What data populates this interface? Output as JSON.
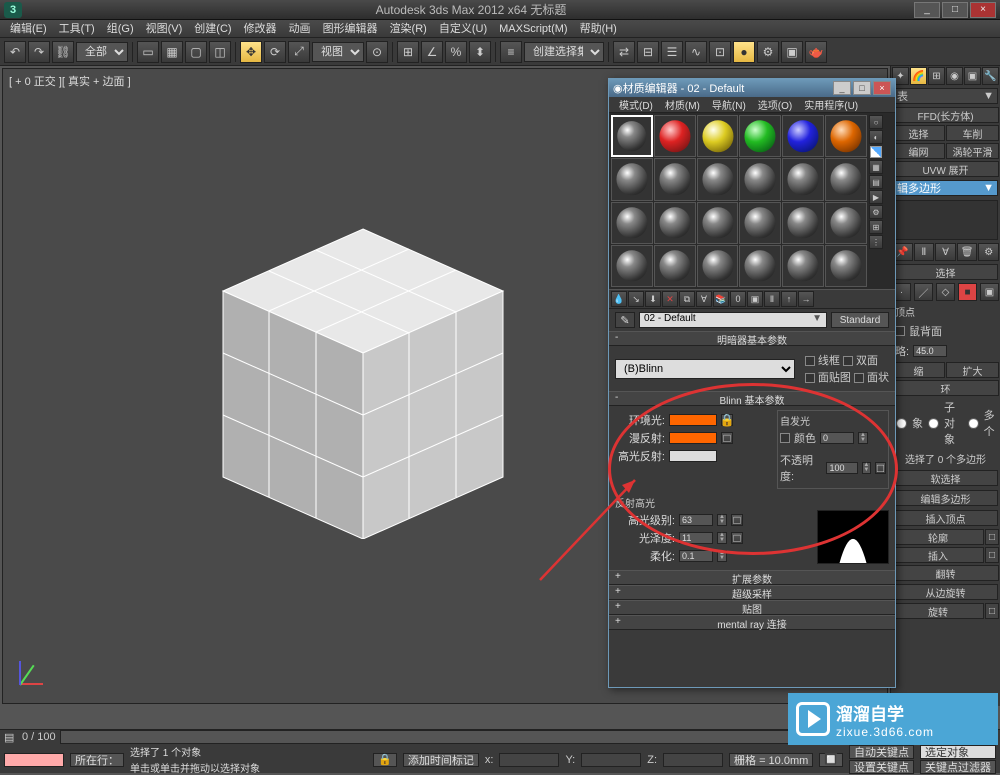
{
  "titlebar": {
    "title": "Autodesk 3ds Max 2012 x64    无标题"
  },
  "menu": [
    "编辑(E)",
    "工具(T)",
    "组(G)",
    "视图(V)",
    "创建(C)",
    "修改器",
    "动画",
    "图形编辑器",
    "渲染(R)",
    "自定义(U)",
    "MAXScript(M)",
    "帮助(H)"
  ],
  "toolbar": {
    "scope": "全部",
    "view": "视图",
    "setdrop": "创建选择集"
  },
  "viewport": {
    "label": "[ + 0 正交 ][ 真实 + 边面 ]"
  },
  "timeline": {
    "range": "0 / 100"
  },
  "status": {
    "sel": "选择了 1 个对象",
    "hint": "单击或单击并拖动以选择对象",
    "nowat": "所在行：",
    "add": "添加时间标记",
    "x": "x:",
    "y": "Y:",
    "z": "Z:",
    "grid": "栅格 = 10.0mm",
    "autokey": "自动关键点",
    "selset": "选定对象",
    "setkey": "设置关键点",
    "filter": "关键点过滤器"
  },
  "cmd": {
    "group": "表",
    "ffd": "FFD(长方体)",
    "sel": "选择",
    "car": "车削",
    "mesh": "编网",
    "turbo": "涡轮平滑",
    "uvw": "UVW 展开",
    "editpoly": "辑多边形",
    "select": "选择",
    "vertex": "顶点",
    "face": "鼠背面",
    "ignore": "略:",
    "angle": "45.0",
    "expand": "扩大",
    "ring": "环",
    "radio1": "象",
    "radio2": "子对象",
    "radio3": "多个",
    "selresult": "选择了 0 个多边形",
    "softsel": "软选择",
    "editpoly2": "编辑多边形",
    "insvert": "插入顶点",
    "outline": "轮廓",
    "inset": "插入",
    "flip": "翻转",
    "hinge": "从边旋转",
    "spin": "旋转"
  },
  "medit": {
    "title": "材质编辑器 - 02 - Default",
    "menu": [
      "模式(D)",
      "材质(M)",
      "导航(N)",
      "选项(O)",
      "实用程序(U)"
    ],
    "name": "02 - Default",
    "type": "Standard",
    "rollups": {
      "shader": "明暗器基本参数",
      "blinn": "Blinn 基本参数",
      "ext": "扩展参数",
      "super": "超级采样",
      "maps": "贴图",
      "mray": "mental ray 连接"
    },
    "shader": {
      "type": "(B)Blinn",
      "wire": "线框",
      "double": "双面",
      "facemap": "面贴图",
      "faceted": "面状"
    },
    "blinn": {
      "group_self": "自发光",
      "amb": "环境光:",
      "diff": "漫反射:",
      "spec": "高光反射:",
      "color": "颜色",
      "opac": "不透明度:",
      "specgroup": "反射高光",
      "speclevel": "高光级别:",
      "gloss": "光泽度:",
      "soften": "柔化:",
      "val": {
        "selfcolor": "0",
        "opac": "100",
        "spec": "63",
        "gloss": "11",
        "soften": "0.1"
      },
      "swatches": {
        "amb": "#ff6600",
        "diff": "#ff6600",
        "spec": "#dddddd",
        "self": "#555555"
      }
    }
  },
  "watermark": {
    "cn": "溜溜自学",
    "en": "zixue.3d66.com"
  }
}
